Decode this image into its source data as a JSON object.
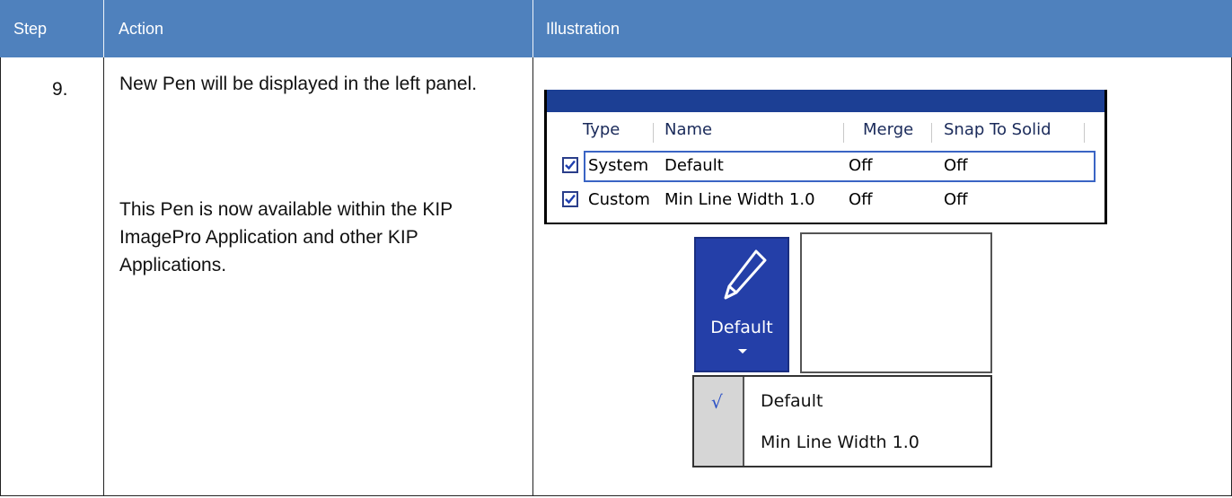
{
  "header": {
    "step": "Step",
    "action": "Action",
    "illustration": "Illustration"
  },
  "row": {
    "step_number": "9.",
    "action_line1": "New Pen will be displayed in the left panel.",
    "action_line2": "This Pen is now available within the KIP ImagePro Application and other KIP Applications."
  },
  "pen_list": {
    "columns": [
      "Type",
      "Name",
      "Merge",
      "Snap To Solid"
    ],
    "rows": [
      {
        "checked": true,
        "type": "System",
        "name": "Default",
        "merge": "Off",
        "snap": "Off",
        "selected": true
      },
      {
        "checked": true,
        "type": "Custom",
        "name": "Min Line Width 1.0",
        "merge": "Off",
        "snap": "Off",
        "selected": false
      }
    ]
  },
  "pen_button": {
    "label": "Default",
    "icon": "pencil-icon"
  },
  "pen_menu": {
    "items": [
      "Default",
      "Min Line Width 1.0"
    ],
    "checked_index": 0,
    "check_glyph": "√"
  },
  "colors": {
    "header_bg": "#4f81bd",
    "grid_titlebar": "#1c3f94",
    "button_bg": "#243fa8"
  }
}
